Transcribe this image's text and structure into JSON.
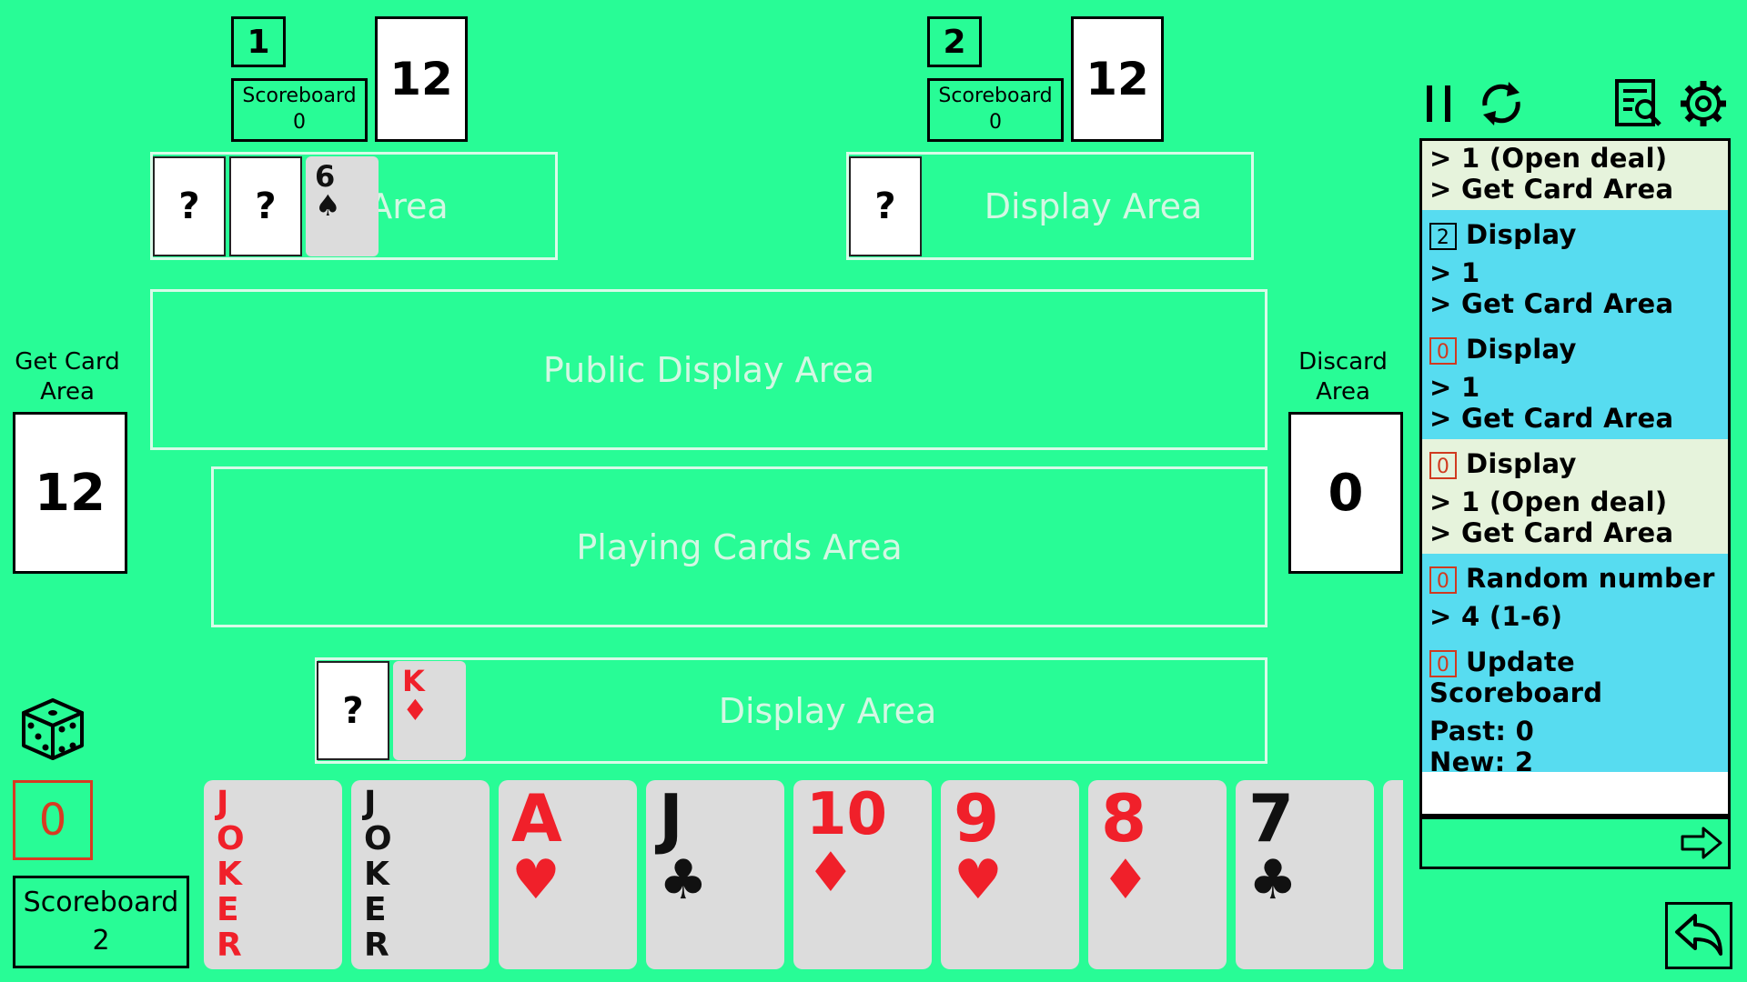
{
  "players": [
    {
      "id": "1",
      "scoreboard_label": "Scoreboard",
      "score": "0",
      "cards_count": "12"
    },
    {
      "id": "2",
      "scoreboard_label": "Scoreboard",
      "score": "0",
      "cards_count": "12"
    }
  ],
  "areas": {
    "p1_display_label": "Area",
    "p2_display_label": "Display Area",
    "public_display": "Public Display Area",
    "playing_cards": "Playing Cards Area",
    "my_display": "Display Area"
  },
  "unknown_card": "?",
  "p1_display_cards": [
    "?",
    "?"
  ],
  "p1_partial_card": {
    "rank": "6",
    "suit": "♠"
  },
  "p2_display_cards": [
    "?"
  ],
  "my_display_cards": [
    "?"
  ],
  "my_partial_card": {
    "rank": "K",
    "suit": "♦"
  },
  "get_card_area": {
    "label_line1": "Get Card",
    "label_line2": "Area",
    "count": "12"
  },
  "discard_area": {
    "label_line1": "Discard",
    "label_line2": "Area",
    "count": "0"
  },
  "me": {
    "score_badge": "0",
    "scoreboard_label": "Scoreboard",
    "score": "2"
  },
  "hand": [
    {
      "rank": "JOKER",
      "suit": "",
      "color": "red"
    },
    {
      "rank": "JOKER",
      "suit": "",
      "color": "black"
    },
    {
      "rank": "A",
      "suit": "♥",
      "color": "red"
    },
    {
      "rank": "J",
      "suit": "♣",
      "color": "black"
    },
    {
      "rank": "10",
      "suit": "♦",
      "color": "red"
    },
    {
      "rank": "9",
      "suit": "♥",
      "color": "red"
    },
    {
      "rank": "8",
      "suit": "♦",
      "color": "red"
    },
    {
      "rank": "7",
      "suit": "♣",
      "color": "black"
    }
  ],
  "log": [
    {
      "style": "light",
      "tag": "",
      "title": "",
      "lines": [
        "> 1 (Open deal)",
        "> Get Card Area"
      ]
    },
    {
      "style": "blue",
      "tag": "2",
      "tag_color": "black",
      "title": "Display",
      "lines": [
        "> 1",
        "> Get Card Area"
      ]
    },
    {
      "style": "blue",
      "tag": "0",
      "tag_color": "red",
      "title": "Display",
      "lines": [
        "> 1",
        "> Get Card Area"
      ]
    },
    {
      "style": "light",
      "tag": "0",
      "tag_color": "red",
      "title": "Display",
      "lines": [
        "> 1 (Open deal)",
        "> Get Card Area"
      ]
    },
    {
      "style": "blue",
      "tag": "0",
      "tag_color": "red",
      "title": "Random number",
      "lines": [
        "> 4 (1-6)"
      ]
    },
    {
      "style": "blue",
      "tag": "0",
      "tag_color": "red",
      "title": "Update Scoreboard",
      "lines": [
        "Past: 0",
        "New: 2"
      ]
    }
  ],
  "colors": {
    "background": "#28fc96",
    "log_blue": "#57dcf0",
    "log_light": "#e6f3dc",
    "red": "#f0202a"
  }
}
